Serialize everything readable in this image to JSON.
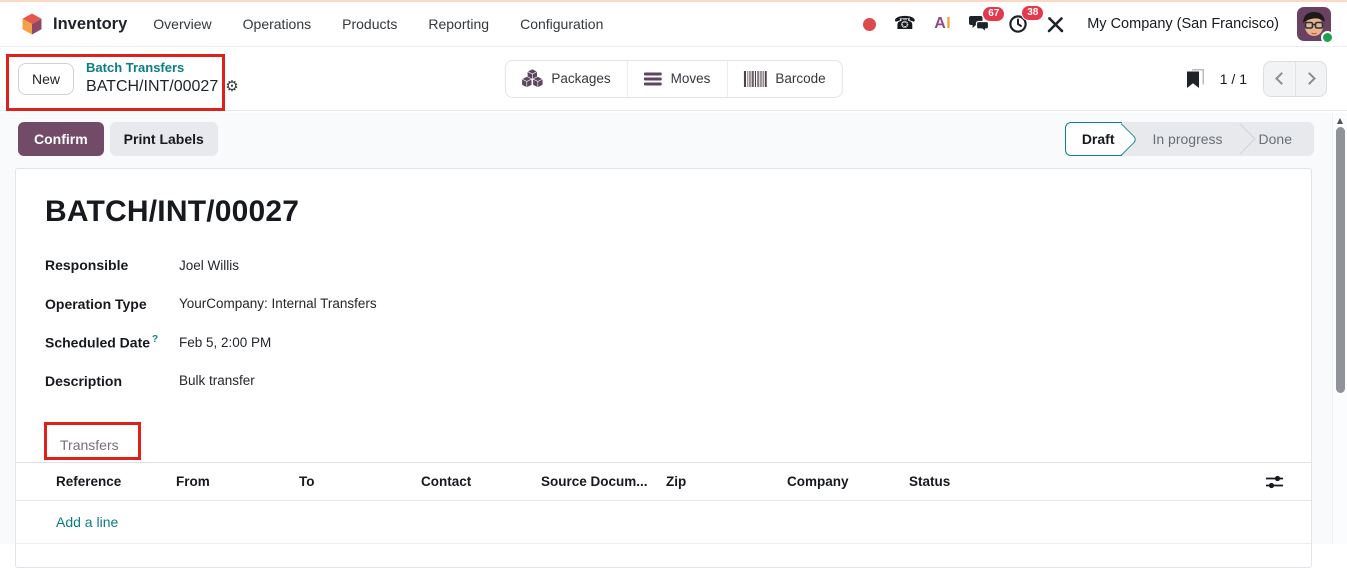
{
  "topbar": {
    "app_name": "Inventory",
    "menu": [
      "Overview",
      "Operations",
      "Products",
      "Reporting",
      "Configuration"
    ],
    "phone_glyph": "☎",
    "ai_a": "A",
    "ai_i": "I",
    "message_badge": "67",
    "activity_badge": "38",
    "company": "My Company (San Francisco)"
  },
  "control_panel": {
    "new_label": "New",
    "breadcrumb_parent": "Batch Transfers",
    "breadcrumb_current": "BATCH/INT/00027",
    "gear_glyph": "⚙",
    "buttons": [
      {
        "label": "Packages"
      },
      {
        "label": "Moves"
      },
      {
        "label": "Barcode"
      }
    ],
    "pager": "1 / 1"
  },
  "actions": {
    "confirm": "Confirm",
    "print_labels": "Print Labels"
  },
  "stages": [
    {
      "label": "Draft",
      "state": "active"
    },
    {
      "label": "In progress",
      "state": ""
    },
    {
      "label": "Done",
      "state": ""
    }
  ],
  "form": {
    "title": "BATCH/INT/00027",
    "fields": [
      {
        "label": "Responsible",
        "value": "Joel Willis"
      },
      {
        "label": "Operation Type",
        "value": "YourCompany: Internal Transfers"
      },
      {
        "label": "Scheduled Date",
        "help": "?",
        "value": "Feb 5, 2:00 PM"
      },
      {
        "label": "Description",
        "value": "Bulk transfer"
      }
    ],
    "tab_label": "Transfers",
    "table": {
      "headers": [
        "Reference",
        "From",
        "To",
        "Contact",
        "Source Docum...",
        "Zip",
        "Company",
        "Status"
      ],
      "add_line_label": "Add a line"
    }
  },
  "scrollbar": {
    "up_glyph": "▲"
  },
  "colors": {
    "accent_purple": "#714B67",
    "link_teal": "#017E84",
    "stage_border_teal": "#0F8289",
    "highlight_red": "#E0201B",
    "badge_red": "#E5394B"
  }
}
